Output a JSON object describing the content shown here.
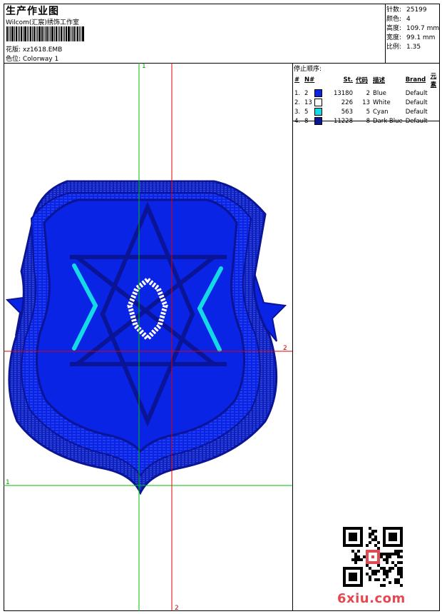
{
  "header": {
    "title": "生产作业图",
    "studio": "Wilcom(汇宸)绣饰工作室",
    "design_label": "花版: xz1618.EMB",
    "colorway_label": "色位: Colorway 1"
  },
  "stats": [
    {
      "key": "针数:",
      "value": "25199"
    },
    {
      "key": "颜色:",
      "value": "4"
    },
    {
      "key": "高度:",
      "value": "109.7 mm"
    },
    {
      "key": "宽度:",
      "value": "99.1 mm"
    },
    {
      "key": "比例:",
      "value": "1.35"
    }
  ],
  "stop_sequence": {
    "title": "停止顺序:",
    "headers": [
      "#",
      "N#",
      "St.",
      "代码",
      "描述",
      "Brand",
      "元素"
    ],
    "rows": [
      {
        "idx": "1.",
        "n": "2",
        "color": "#0a24e6",
        "st": "13180",
        "code": "2",
        "desc": "Blue",
        "brand": "Default"
      },
      {
        "idx": "2.",
        "n": "13",
        "color": "#ffffff",
        "st": "226",
        "code": "13",
        "desc": "White",
        "brand": "Default"
      },
      {
        "idx": "3.",
        "n": "5",
        "color": "#14d9e6",
        "st": "563",
        "code": "5",
        "desc": "Cyan",
        "brand": "Default"
      },
      {
        "idx": "4.",
        "n": "8",
        "color": "#0a1496",
        "st": "11228",
        "code": "8",
        "desc": "Dark Blue",
        "brand": "Default"
      }
    ]
  },
  "guides": {
    "green_v": "1",
    "green_h": "1",
    "red_h": "2",
    "red_v": "2"
  },
  "watermark": "6xiu.com"
}
